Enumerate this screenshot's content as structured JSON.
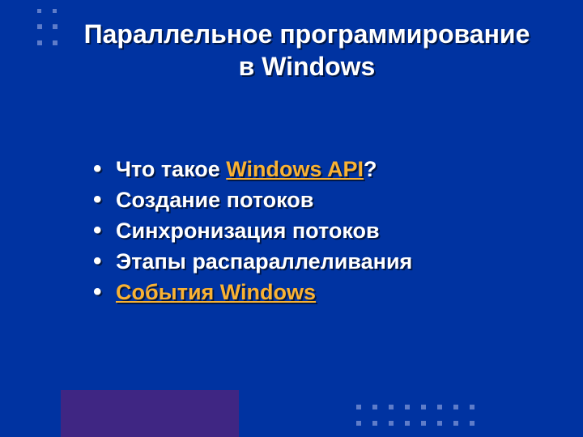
{
  "title": {
    "line1": "Параллельное программирование",
    "line2": "в Windows"
  },
  "bullets": {
    "b0": {
      "pre": "Что такое ",
      "link": "Windows API",
      "post": "?"
    },
    "b1": {
      "text": "Создание потоков"
    },
    "b2": {
      "text": "Синхронизация потоков"
    },
    "b3": {
      "text": "Этапы распараллеливания"
    },
    "b4": {
      "link": "События Windows"
    }
  }
}
